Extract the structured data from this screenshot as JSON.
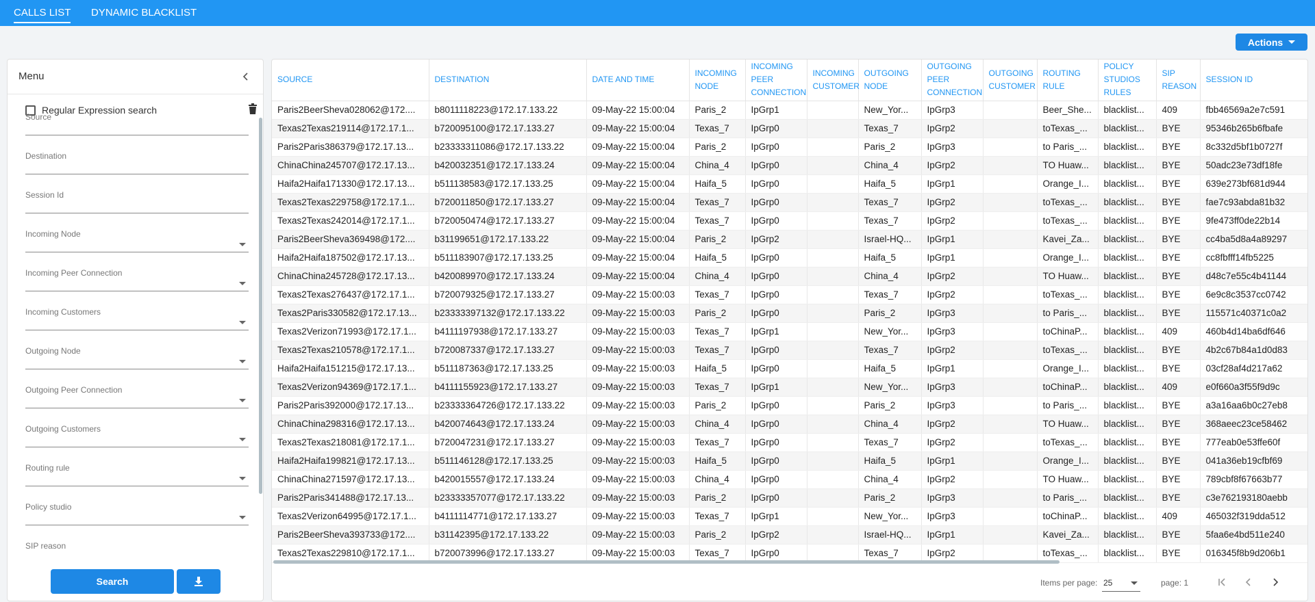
{
  "tabs": [
    {
      "label": "CALLS LIST",
      "active": true
    },
    {
      "label": "DYNAMIC BLACKLIST",
      "active": false
    }
  ],
  "actions": {
    "label": "Actions"
  },
  "sidebar": {
    "title": "Menu",
    "regex_label": "Regular Expression search",
    "fields": [
      {
        "label": "Source",
        "type": "text"
      },
      {
        "label": "Destination",
        "type": "text"
      },
      {
        "label": "Session Id",
        "type": "text"
      },
      {
        "label": "Incoming Node",
        "type": "select"
      },
      {
        "label": "Incoming Peer Connection",
        "type": "select"
      },
      {
        "label": "Incoming Customers",
        "type": "select"
      },
      {
        "label": "Outgoing Node",
        "type": "select"
      },
      {
        "label": "Outgoing Peer Connection",
        "type": "select"
      },
      {
        "label": "Outgoing Customers",
        "type": "select"
      },
      {
        "label": "Routing rule",
        "type": "select"
      },
      {
        "label": "Policy studio",
        "type": "select"
      },
      {
        "label": "SIP reason",
        "type": "select"
      }
    ],
    "search_label": "Search"
  },
  "table": {
    "columns": [
      "SOURCE",
      "DESTINATION",
      "DATE AND TIME",
      "INCOMING NODE",
      "INCOMING PEER CONNECTION",
      "INCOMING CUSTOMER",
      "OUTGOING NODE",
      "OUTGOING PEER CONNECTION",
      "OUTGOING CUSTOMER",
      "ROUTING RULE",
      "POLICY STUDIOS RULES",
      "SIP REASON",
      "SESSION ID"
    ],
    "rows": [
      [
        "Paris2BeerSheva028062@172....",
        "b8011118223@172.17.133.22",
        "09-May-22 15:00:04",
        "Paris_2",
        "IpGrp1",
        "",
        "New_Yor...",
        "IpGrp3",
        "",
        "Beer_She...",
        "blacklist...",
        "409",
        "fbb46569a2e7c591"
      ],
      [
        "Texas2Texas219114@172.17.1...",
        "b720095100@172.17.133.27",
        "09-May-22 15:00:04",
        "Texas_7",
        "IpGrp0",
        "",
        "Texas_7",
        "IpGrp2",
        "",
        "toTexas_...",
        "blacklist...",
        "BYE",
        "95346b265b6fbafe"
      ],
      [
        "Paris2Paris386379@172.17.13...",
        "b23333311086@172.17.133.22",
        "09-May-22 15:00:04",
        "Paris_2",
        "IpGrp0",
        "",
        "Paris_2",
        "IpGrp3",
        "",
        "to Paris_...",
        "blacklist...",
        "BYE",
        "8c332d5bf1b0727f"
      ],
      [
        "ChinaChina245707@172.17.13...",
        "b420032351@172.17.133.24",
        "09-May-22 15:00:04",
        "China_4",
        "IpGrp0",
        "",
        "China_4",
        "IpGrp2",
        "",
        "TO Huaw...",
        "blacklist...",
        "BYE",
        "50adc23e73df18fe"
      ],
      [
        "Haifa2Haifa171330@172.17.13...",
        "b511138583@172.17.133.25",
        "09-May-22 15:00:04",
        "Haifa_5",
        "IpGrp0",
        "",
        "Haifa_5",
        "IpGrp1",
        "",
        "Orange_I...",
        "blacklist...",
        "BYE",
        "639e273bf681d944"
      ],
      [
        "Texas2Texas229758@172.17.1...",
        "b720011850@172.17.133.27",
        "09-May-22 15:00:04",
        "Texas_7",
        "IpGrp0",
        "",
        "Texas_7",
        "IpGrp2",
        "",
        "toTexas_...",
        "blacklist...",
        "BYE",
        "fae7c93abda81b32"
      ],
      [
        "Texas2Texas242014@172.17.1...",
        "b720050474@172.17.133.27",
        "09-May-22 15:00:04",
        "Texas_7",
        "IpGrp0",
        "",
        "Texas_7",
        "IpGrp2",
        "",
        "toTexas_...",
        "blacklist...",
        "BYE",
        "9fe473ff0de22b14"
      ],
      [
        "Paris2BeerSheva369498@172....",
        "b31199651@172.17.133.22",
        "09-May-22 15:00:04",
        "Paris_2",
        "IpGrp2",
        "",
        "Israel-HQ...",
        "IpGrp1",
        "",
        "Kavei_Za...",
        "blacklist...",
        "BYE",
        "cc4ba5d8a4a89297"
      ],
      [
        "Haifa2Haifa187502@172.17.13...",
        "b511183907@172.17.133.25",
        "09-May-22 15:00:04",
        "Haifa_5",
        "IpGrp0",
        "",
        "Haifa_5",
        "IpGrp1",
        "",
        "Orange_I...",
        "blacklist...",
        "BYE",
        "cc8fbfff14fb5225"
      ],
      [
        "ChinaChina245728@172.17.13...",
        "b420089970@172.17.133.24",
        "09-May-22 15:00:04",
        "China_4",
        "IpGrp0",
        "",
        "China_4",
        "IpGrp2",
        "",
        "TO Huaw...",
        "blacklist...",
        "BYE",
        "d48c7e55c4b41144"
      ],
      [
        "Texas2Texas276437@172.17.1...",
        "b720079325@172.17.133.27",
        "09-May-22 15:00:03",
        "Texas_7",
        "IpGrp0",
        "",
        "Texas_7",
        "IpGrp2",
        "",
        "toTexas_...",
        "blacklist...",
        "BYE",
        "6e9c8c3537cc0742"
      ],
      [
        "Texas2Paris330582@172.17.13...",
        "b23333397132@172.17.133.22",
        "09-May-22 15:00:03",
        "Paris_2",
        "IpGrp0",
        "",
        "Paris_2",
        "IpGrp3",
        "",
        "to Paris_...",
        "blacklist...",
        "BYE",
        "115571c40371c0a2"
      ],
      [
        "Texas2Verizon71993@172.17.1...",
        "b4111197938@172.17.133.27",
        "09-May-22 15:00:03",
        "Texas_7",
        "IpGrp1",
        "",
        "New_Yor...",
        "IpGrp3",
        "",
        "toChinaP...",
        "blacklist...",
        "409",
        "460b4d14ba6df646"
      ],
      [
        "Texas2Texas210578@172.17.1...",
        "b720087337@172.17.133.27",
        "09-May-22 15:00:03",
        "Texas_7",
        "IpGrp0",
        "",
        "Texas_7",
        "IpGrp2",
        "",
        "toTexas_...",
        "blacklist...",
        "BYE",
        "4b2c67b84a1d0d83"
      ],
      [
        "Haifa2Haifa151215@172.17.13...",
        "b511187363@172.17.133.25",
        "09-May-22 15:00:03",
        "Haifa_5",
        "IpGrp0",
        "",
        "Haifa_5",
        "IpGrp1",
        "",
        "Orange_I...",
        "blacklist...",
        "BYE",
        "03cf28af4d217a62"
      ],
      [
        "Texas2Verizon94369@172.17.1...",
        "b4111155923@172.17.133.27",
        "09-May-22 15:00:03",
        "Texas_7",
        "IpGrp1",
        "",
        "New_Yor...",
        "IpGrp3",
        "",
        "toChinaP...",
        "blacklist...",
        "409",
        "e0f660a3f55f9d9c"
      ],
      [
        "Paris2Paris392000@172.17.13...",
        "b23333364726@172.17.133.22",
        "09-May-22 15:00:03",
        "Paris_2",
        "IpGrp0",
        "",
        "Paris_2",
        "IpGrp3",
        "",
        "to Paris_...",
        "blacklist...",
        "BYE",
        "a3a16aa6b0c27eb8"
      ],
      [
        "ChinaChina298316@172.17.13...",
        "b420074643@172.17.133.24",
        "09-May-22 15:00:03",
        "China_4",
        "IpGrp0",
        "",
        "China_4",
        "IpGrp2",
        "",
        "TO Huaw...",
        "blacklist...",
        "BYE",
        "368aeec23ce58462"
      ],
      [
        "Texas2Texas218081@172.17.1...",
        "b720047231@172.17.133.27",
        "09-May-22 15:00:03",
        "Texas_7",
        "IpGrp0",
        "",
        "Texas_7",
        "IpGrp2",
        "",
        "toTexas_...",
        "blacklist...",
        "BYE",
        "777eab0e53ffe60f"
      ],
      [
        "Haifa2Haifa199821@172.17.13...",
        "b511146128@172.17.133.25",
        "09-May-22 15:00:03",
        "Haifa_5",
        "IpGrp0",
        "",
        "Haifa_5",
        "IpGrp1",
        "",
        "Orange_I...",
        "blacklist...",
        "BYE",
        "041a36eb19cfbf69"
      ],
      [
        "ChinaChina271597@172.17.13...",
        "b420015557@172.17.133.24",
        "09-May-22 15:00:03",
        "China_4",
        "IpGrp0",
        "",
        "China_4",
        "IpGrp2",
        "",
        "TO Huaw...",
        "blacklist...",
        "BYE",
        "789cbf8f67663b77"
      ],
      [
        "Paris2Paris341488@172.17.13...",
        "b23333357077@172.17.133.22",
        "09-May-22 15:00:03",
        "Paris_2",
        "IpGrp0",
        "",
        "Paris_2",
        "IpGrp3",
        "",
        "to Paris_...",
        "blacklist...",
        "BYE",
        "c3e762193180aebb"
      ],
      [
        "Texas2Verizon64995@172.17.1...",
        "b4111114771@172.17.133.27",
        "09-May-22 15:00:03",
        "Texas_7",
        "IpGrp1",
        "",
        "New_Yor...",
        "IpGrp3",
        "",
        "toChinaP...",
        "blacklist...",
        "409",
        "465032f319dda512"
      ],
      [
        "Paris2BeerSheva393733@172....",
        "b31142395@172.17.133.22",
        "09-May-22 15:00:03",
        "Paris_2",
        "IpGrp2",
        "",
        "Israel-HQ...",
        "IpGrp1",
        "",
        "Kavei_Za...",
        "blacklist...",
        "BYE",
        "5faa6e4bd511e240"
      ],
      [
        "Texas2Texas229810@172.17.1...",
        "b720073996@172.17.133.27",
        "09-May-22 15:00:03",
        "Texas_7",
        "IpGrp0",
        "",
        "Texas_7",
        "IpGrp2",
        "",
        "toTexas_...",
        "blacklist...",
        "BYE",
        "016345f8b9d206b1"
      ]
    ]
  },
  "paginator": {
    "items_per_page_label": "Items per page:",
    "items_per_page_value": "25",
    "page_label": "page: 1"
  },
  "colors": {
    "primary": "#2196f3",
    "button": "#1e88e5"
  }
}
